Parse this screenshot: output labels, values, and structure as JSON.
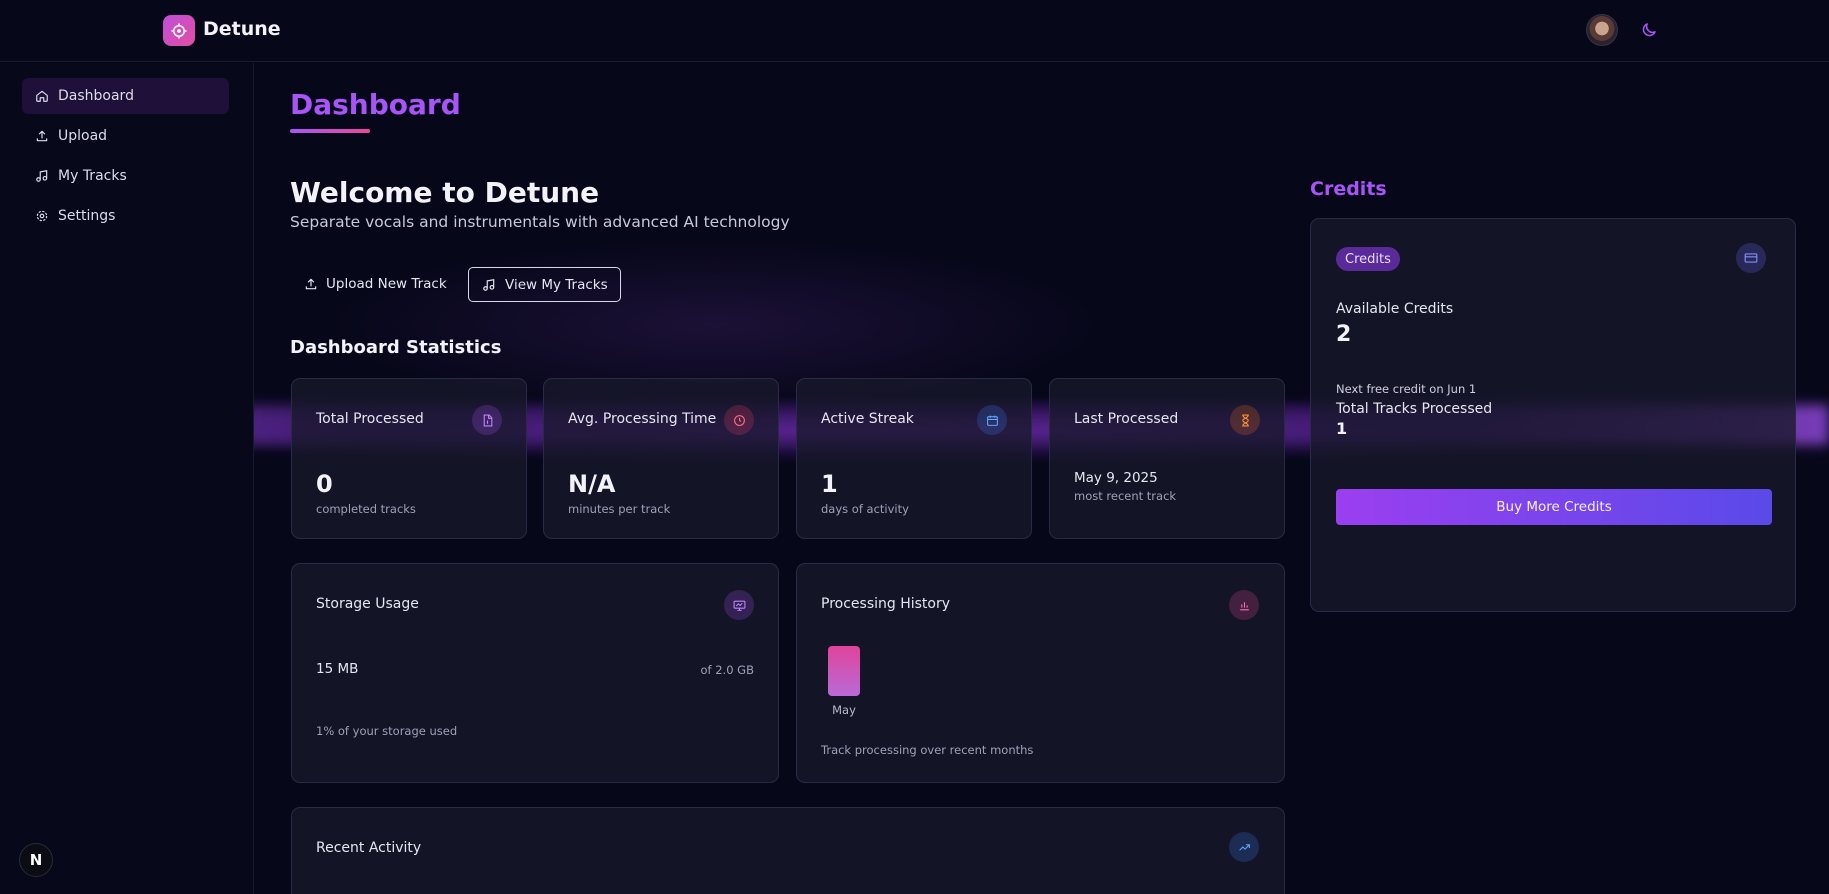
{
  "app": {
    "name": "Detune"
  },
  "sidebar": {
    "items": [
      {
        "label": "Dashboard",
        "icon": "home-icon",
        "active": true
      },
      {
        "label": "Upload",
        "icon": "upload-icon"
      },
      {
        "label": "My Tracks",
        "icon": "music-note-icon"
      },
      {
        "label": "Settings",
        "icon": "gear-icon"
      }
    ],
    "footer_badge": "N"
  },
  "header": {
    "page_title": "Dashboard"
  },
  "welcome": {
    "title": "Welcome to Detune",
    "subtitle": "Separate vocals and instrumentals with advanced AI technology",
    "upload_button": "Upload New Track",
    "view_button": "View My Tracks"
  },
  "stats": {
    "title": "Dashboard Statistics",
    "cards": [
      {
        "label": "Total Processed",
        "value": "0",
        "caption": "completed tracks",
        "icon": "file-audio-icon",
        "color": "#a855f7"
      },
      {
        "label": "Avg. Processing Time",
        "value": "N/A",
        "caption": "minutes per track",
        "icon": "clock-icon",
        "color": "#f43f5e"
      },
      {
        "label": "Active Streak",
        "value": "1",
        "caption": "days of activity",
        "icon": "calendar-icon",
        "color": "#3b82f6"
      },
      {
        "label": "Last Processed",
        "value": "May 9, 2025",
        "caption": "most recent track",
        "icon": "hourglass-icon",
        "color": "#f97316"
      }
    ]
  },
  "storage": {
    "label": "Storage Usage",
    "used": "15 MB",
    "total": "of 2.0 GB",
    "caption": "1% of your storage used",
    "icon": "monitor-icon"
  },
  "history": {
    "label": "Processing History",
    "caption": "Track processing over recent months",
    "icon": "bar-chart-icon",
    "bars": [
      {
        "month": "May",
        "value": 1
      }
    ]
  },
  "recent": {
    "label": "Recent Activity",
    "icon": "trending-up-icon"
  },
  "credits": {
    "section_title": "Credits",
    "pill": "Credits",
    "available_label": "Available Credits",
    "available_value": "2",
    "next_free": "Next free credit on Jun 1",
    "total_label": "Total Tracks Processed",
    "total_value": "1",
    "buy_button": "Buy More Credits",
    "icon": "credit-card-icon"
  }
}
